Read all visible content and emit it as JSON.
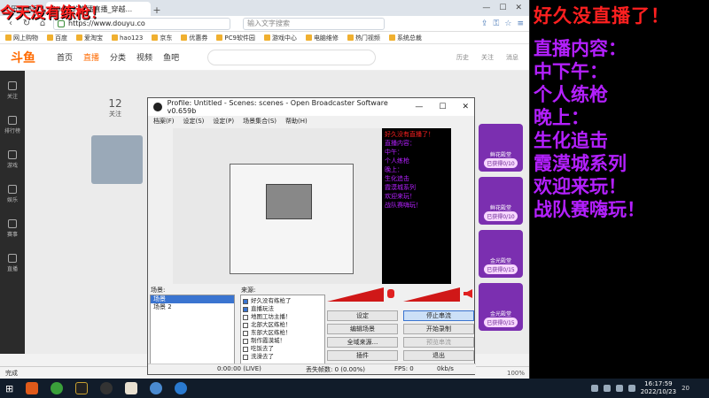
{
  "banner": "今天没有练枪！",
  "browser": {
    "tabs": [
      {
        "label": "历史记录"
      },
      {
        "label": "Night的直播直播_穿越..."
      }
    ],
    "url": "https://www.douyu.co",
    "search_placeholder": "输入文字搜索",
    "bookmarks": [
      "网上购物",
      "百度",
      "爱淘宝",
      "hao123",
      "京东",
      "优惠券",
      "PC9软件园",
      "游戏中心",
      "电脑维修",
      "热门视频",
      "系统总裁"
    ],
    "status_text": "完成",
    "zoom": "100%"
  },
  "douyu": {
    "logo": "斗鱼",
    "nav": [
      "首页",
      "直播",
      "分类",
      "视频",
      "鱼吧"
    ],
    "user_icons": [
      "历史",
      "关注",
      "消息"
    ],
    "sidebar": [
      "关注",
      "排行榜",
      "游戏",
      "娱乐",
      "赛事",
      "直播"
    ],
    "follower_count": "12",
    "follower_label": "关注",
    "card_labels": [
      "鱼吧",
      "公会"
    ],
    "right_cards": [
      {
        "title": "鲜花殿堂",
        "pill": "已获得0/10"
      },
      {
        "title": "鲜花殿堂",
        "pill": "已获得0/10"
      },
      {
        "title": "金光殿堂",
        "pill": "已获得0/15"
      },
      {
        "title": "金光殿堂",
        "pill": "已获得0/15"
      }
    ]
  },
  "obs": {
    "title": "Profile: Untitled - Scenes: scenes - Open Broadcaster Software v0.659b",
    "menu": [
      "档案(F)",
      "设定(S)",
      "设定(P)",
      "场景集合(S)",
      "帮助(H)"
    ],
    "scenes_label": "场景:",
    "sources_label": "来源:",
    "scenes": [
      "场景",
      "场景 2"
    ],
    "sources": [
      {
        "label": "好久没有练枪了",
        "checked": true
      },
      {
        "label": "直播玩法",
        "checked": true
      },
      {
        "label": "地图工坊主播！",
        "checked": false
      },
      {
        "label": "北部大区练枪！",
        "checked": false
      },
      {
        "label": "东部大区练枪！",
        "checked": false
      },
      {
        "label": "制作霞漠城！",
        "checked": false
      },
      {
        "label": "吃饭去了",
        "checked": false
      },
      {
        "label": "洗澡去了",
        "checked": false
      }
    ],
    "buttons": {
      "settings": "设定",
      "stop_stream": "停止串流",
      "edit_scene": "编辑场景",
      "start_record": "开始录制",
      "global_sources": "全域来源...",
      "preview_stream": "预览串流",
      "plugins": "插件",
      "exit": "退出"
    },
    "status": {
      "time": "0:00:00 (LIVE)",
      "dropped": "丢失帧数: 0 (0.00%)",
      "fps": "FPS: 0",
      "bitrate": "0kb/s"
    },
    "preview_panel_title": "好久没有直播了！",
    "preview_panel_lines": [
      "直播内容：",
      "中午：",
      "个人练枪",
      "晚上：",
      "生化追击",
      "霞漠城系列",
      "欢迎来玩！",
      "战队赛嗨玩！"
    ]
  },
  "side_panel": {
    "title": "好久没直播了！",
    "lines": [
      "直播内容：",
      "中下午：",
      "个人练枪",
      "晚上：",
      "生化追击",
      "霞漠城系列",
      "欢迎来玩！",
      "战队赛嗨玩！"
    ]
  },
  "taskbar": {
    "time": "16:17:59",
    "date": "2022/10/23",
    "notif": "20"
  },
  "colors": {
    "banner_red": "#ff2020",
    "side_purple": "#b420ff",
    "douyu_orange": "#ff6a00"
  }
}
